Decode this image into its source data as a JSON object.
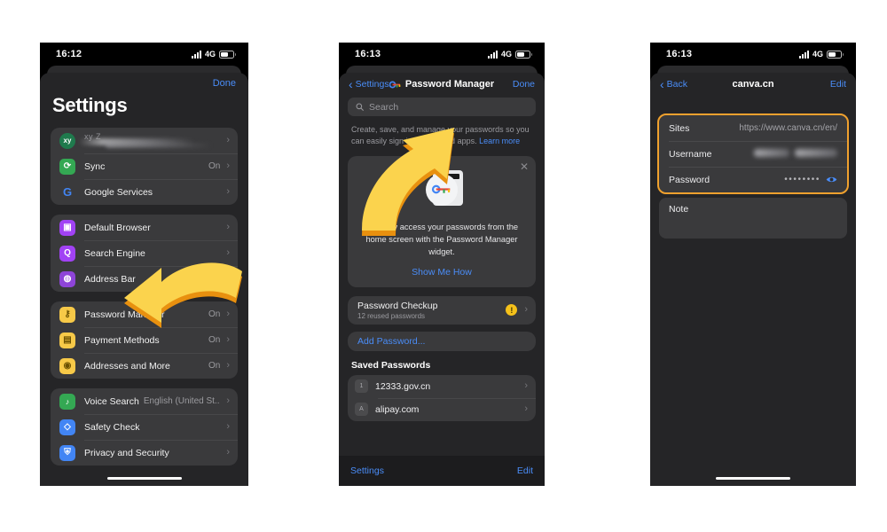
{
  "phone1": {
    "status": {
      "time": "16:12",
      "network": "4G"
    },
    "done_label": "Done",
    "title": "Settings",
    "groups": [
      {
        "items": [
          {
            "icon": "account-avatar-icon",
            "icon_text": "xy",
            "icon_color": "#1f7a4d",
            "label": "",
            "redacted_label": "xy Z",
            "value": "",
            "chevron": "›"
          },
          {
            "icon": "sync-icon",
            "icon_text": "⟳",
            "icon_color": "#34a853",
            "label": "Sync",
            "value": "On",
            "chevron": "›"
          },
          {
            "icon": "google-services-icon",
            "icon_text": "G",
            "icon_color": "#ffffff",
            "label": "Google Services",
            "value": "",
            "chevron": "›"
          }
        ]
      },
      {
        "items": [
          {
            "icon": "default-browser-icon",
            "icon_text": "▣",
            "icon_color": "#a142f4",
            "label": "Default Browser",
            "value": "",
            "chevron": "›"
          },
          {
            "icon": "search-engine-icon",
            "icon_text": "Q",
            "icon_color": "#a142f4",
            "label": "Search Engine",
            "value": "",
            "chevron": "›"
          },
          {
            "icon": "address-bar-icon",
            "icon_text": "◍",
            "icon_color": "#8e44d8",
            "label": "Address Bar",
            "value": "Top",
            "chevron": "›"
          }
        ]
      },
      {
        "items": [
          {
            "icon": "password-manager-icon",
            "icon_text": "⚷",
            "icon_color": "#f7c948",
            "label": "Password Manager",
            "value": "On",
            "chevron": "›"
          },
          {
            "icon": "payment-methods-icon",
            "icon_text": "▤",
            "icon_color": "#f7c948",
            "label": "Payment Methods",
            "value": "On",
            "chevron": "›"
          },
          {
            "icon": "addresses-icon",
            "icon_text": "◉",
            "icon_color": "#f7c948",
            "label": "Addresses and More",
            "value": "On",
            "chevron": "›"
          }
        ]
      },
      {
        "items": [
          {
            "icon": "voice-search-icon",
            "icon_text": "🎤",
            "icon_color": "#34a853",
            "label": "Voice Search",
            "value": "English (United St...",
            "chevron": "›"
          },
          {
            "icon": "safety-check-icon",
            "icon_text": "◇",
            "icon_color": "#4285f4",
            "label": "Safety Check",
            "value": "",
            "chevron": "›"
          },
          {
            "icon": "privacy-security-icon",
            "icon_text": "⛨",
            "icon_color": "#4285f4",
            "label": "Privacy and Security",
            "value": "",
            "chevron": "›"
          }
        ]
      }
    ]
  },
  "phone2": {
    "status": {
      "time": "16:13",
      "network": "4G"
    },
    "nav": {
      "back_label": "Settings",
      "back_chevron": "‹",
      "title": "Password Manager",
      "title_icon": "google-password-key-icon",
      "done_label": "Done"
    },
    "search": {
      "placeholder": "Search",
      "icon": "search-icon"
    },
    "description": "Create, save, and manage your passwords so you can easily sign in to sites and apps.",
    "description_link": "Learn more",
    "promo": {
      "close_icon": "close-icon",
      "text": "Securely access your passwords from the home screen with the Password Manager widget.",
      "cta": "Show Me How"
    },
    "checkup": {
      "title": "Password Checkup",
      "subtitle": "12 reused passwords",
      "badge": "!",
      "badge_color": "#f5c11a",
      "chevron": "›"
    },
    "add_password": "Add Password...",
    "saved_heading": "Saved Passwords",
    "saved": [
      {
        "favicon": "1",
        "name": "12333.gov.cn",
        "chevron": "›"
      },
      {
        "favicon": "A",
        "name": "alipay.com",
        "chevron": "›"
      }
    ],
    "toolbar": {
      "left": "Settings",
      "right": "Edit"
    }
  },
  "phone3": {
    "status": {
      "time": "16:13",
      "network": "4G"
    },
    "nav": {
      "back_label": "Back",
      "back_chevron": "‹",
      "title": "canva.cn",
      "edit_label": "Edit"
    },
    "highlight_color": "#f0a12e",
    "fields": [
      {
        "key": "Sites",
        "value": "https://www.canva.cn/en/",
        "type": "text"
      },
      {
        "key": "Username",
        "value": "",
        "type": "redacted"
      },
      {
        "key": "Password",
        "value": "••••••••",
        "type": "password",
        "reveal_icon": "eye-icon"
      }
    ],
    "note": {
      "key": "Note",
      "value": ""
    }
  },
  "annotations": [
    {
      "name": "arrow-to-password-manager",
      "color": "#f7c948",
      "shadow": "#e8900f",
      "direction": "down-left"
    },
    {
      "name": "arrow-to-search-field",
      "color": "#f7c948",
      "shadow": "#e8900f",
      "direction": "up-right"
    }
  ]
}
